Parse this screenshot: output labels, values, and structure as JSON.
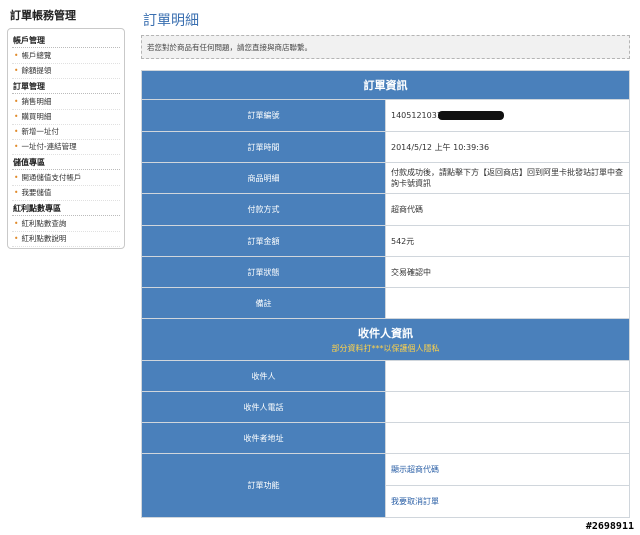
{
  "sidebar": {
    "title": "訂單帳務管理",
    "sections": [
      {
        "label": "帳戶管理",
        "items": [
          "帳戶總覽",
          "餘額提領"
        ]
      },
      {
        "label": "訂單管理",
        "items": [
          "銷售明細",
          "購買明細",
          "新增一址付",
          "一址付-連結管理"
        ]
      },
      {
        "label": "儲值專區",
        "items": [
          "開通儲值支付帳戶",
          "我要儲值"
        ]
      },
      {
        "label": "紅利點數專區",
        "items": [
          "紅利點數查詢",
          "紅利點數說明"
        ]
      }
    ]
  },
  "main": {
    "title": "訂單明細",
    "notice": "若您對於商品有任何問題，請您直接與商店聯繫。",
    "order_section": {
      "title": "訂單資訊",
      "rows": [
        {
          "label": "訂單編號",
          "value": "1405121031"
        },
        {
          "label": "訂單時間",
          "value": "2014/5/12 上午 10:39:36"
        },
        {
          "label": "商品明細",
          "value": "付款成功後，請點擊下方【返回商店】回到阿里卡批發站訂單中查詢卡號資訊"
        },
        {
          "label": "付款方式",
          "value": "超商代碼"
        },
        {
          "label": "訂單金額",
          "value": "542元"
        },
        {
          "label": "訂單狀態",
          "value": "交易確認中"
        },
        {
          "label": "備註",
          "value": ""
        }
      ]
    },
    "recipient_section": {
      "title": "收件人資訊",
      "subtitle": "部分資料打***以保護個人隱私",
      "rows": [
        {
          "label": "收件人",
          "value": ""
        },
        {
          "label": "收件人電話",
          "value": ""
        },
        {
          "label": "收件者地址",
          "value": ""
        }
      ],
      "functions_label": "訂單功能",
      "functions": [
        "顯示超商代碼",
        "我要取消訂單"
      ]
    }
  },
  "watermark": "#2698911"
}
